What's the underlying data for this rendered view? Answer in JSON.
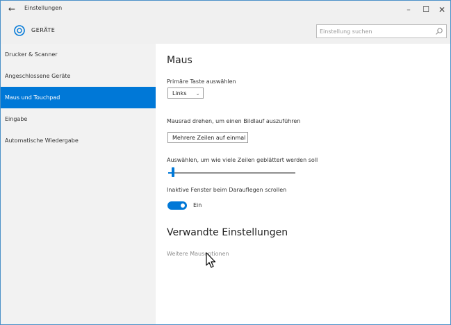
{
  "window": {
    "title": "Einstellungen",
    "controls": {
      "minimize": "–",
      "maximize": "☐",
      "close": "✕"
    }
  },
  "header": {
    "section_title": "GERÄTE",
    "icon": "devices-gear-icon",
    "search_placeholder": "Einstellung suchen",
    "search_icon": "search-icon"
  },
  "sidebar": {
    "items": [
      {
        "label": "Drucker & Scanner",
        "selected": false
      },
      {
        "label": "Angeschlossene Geräte",
        "selected": false
      },
      {
        "label": "Maus und Touchpad",
        "selected": true
      },
      {
        "label": "Eingabe",
        "selected": false
      },
      {
        "label": "Automatische Wiedergabe",
        "selected": false
      }
    ]
  },
  "main": {
    "title": "Maus",
    "primary_button_label": "Primäre Taste auswählen",
    "primary_button_value": "Links",
    "scroll_label": "Mausrad drehen, um einen Bildlauf auszuführen",
    "scroll_value": "Mehrere Zeilen auf einmal",
    "lines_label": "Auswählen, um wie viele Zeilen geblättert werden soll",
    "lines_slider_fraction": 0.03,
    "inactive_scroll_label": "Inaktive Fenster beim Darauflegen scrollen",
    "inactive_scroll_state": "Ein",
    "related_title": "Verwandte Einstellungen",
    "related_link": "Weitere Mausoptionen"
  },
  "colors": {
    "accent": "#0078d7",
    "sidebar_bg": "#f2f2f2",
    "link_gray": "#8c8c8c"
  }
}
